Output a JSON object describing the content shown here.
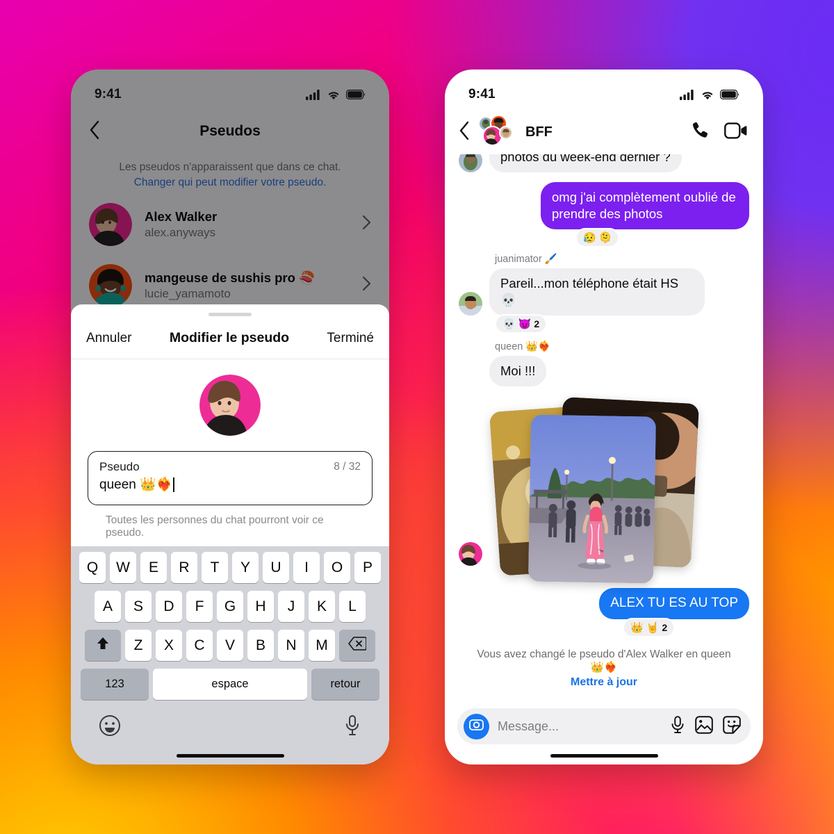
{
  "background": {
    "colors": [
      "#E800B0",
      "#FF2050",
      "#FF9000",
      "#FFC400",
      "#6A2BF5",
      "#FF1B6B"
    ]
  },
  "left_phone": {
    "status_bar": {
      "time": "9:41",
      "signal_icon": "cellular-bars-icon",
      "wifi_icon": "wifi-icon",
      "battery_icon": "battery-full-icon"
    },
    "nav": {
      "back_icon": "chevron-left-icon",
      "title": "Pseudos"
    },
    "subtitle": {
      "muted_text": "Les pseudos n'apparaissent que dans ce chat.",
      "link_text": "Changer qui peut modifier votre pseudo."
    },
    "people": [
      {
        "name": "Alex Walker",
        "handle": "alex.anyways",
        "chevron_icon": "chevron-right-icon",
        "avatar_bg": "#E8238E"
      },
      {
        "name": "mangeuse de sushis pro 🍣",
        "handle": "lucie_yamamoto",
        "chevron_icon": "chevron-right-icon",
        "avatar_bg": "#F04A12"
      }
    ],
    "sheet": {
      "grabber": "drag-handle",
      "cancel_label": "Annuler",
      "title": "Modifier le pseudo",
      "done_label": "Terminé",
      "avatar_name": "alex-walker-avatar",
      "field": {
        "label": "Pseudo",
        "value": "queen 👑❤️‍🔥",
        "counter": "8 / 32",
        "placeholder": "Pseudo"
      },
      "help_text": "Toutes les personnes du chat pourront voir ce pseudo."
    },
    "keyboard": {
      "row1": [
        "Q",
        "W",
        "E",
        "R",
        "T",
        "Y",
        "U",
        "I",
        "O",
        "P"
      ],
      "row2": [
        "A",
        "S",
        "D",
        "F",
        "G",
        "H",
        "J",
        "K",
        "L"
      ],
      "row3": [
        "Z",
        "X",
        "C",
        "V",
        "B",
        "N",
        "M"
      ],
      "shift_icon": "shift-arrow-icon",
      "delete_icon": "backspace-icon",
      "numbers_label": "123",
      "space_label": "espace",
      "return_label": "retour",
      "emoji_icon": "emoji-smiley-icon",
      "dictate_icon": "microphone-icon"
    }
  },
  "right_phone": {
    "status_bar": {
      "time": "9:41",
      "signal_icon": "cellular-bars-icon",
      "wifi_icon": "wifi-icon",
      "battery_icon": "battery-full-icon"
    },
    "thread_header": {
      "back_icon": "chevron-left-icon",
      "avatars_name": "group-avatar-cluster",
      "title": "BFF",
      "call_icon": "phone-call-icon",
      "video_icon": "video-camera-icon"
    },
    "messages": [
      {
        "id": "m1",
        "direction": "in",
        "text": "photos du week-end dernier ?",
        "partial_top": true,
        "avatar": "juanimator-avatar"
      },
      {
        "id": "m2",
        "direction": "out",
        "text": "omg j'ai complètement oublié de prendre des photos",
        "bubble_color": "#7C20EF",
        "reactions": {
          "emojis": [
            "😥",
            "🫠"
          ],
          "count": ""
        }
      },
      {
        "id": "m3",
        "direction": "in",
        "sender": "juanimator 🖌️",
        "text": "Pareil...mon téléphone était HS 💀",
        "avatar": "juanimator-avatar",
        "reactions": {
          "emojis": [
            "💀",
            "😈"
          ],
          "count": "2"
        }
      },
      {
        "id": "m4",
        "direction": "in",
        "sender": "queen 👑❤️‍🔥",
        "text": "Moi !!!"
      },
      {
        "id": "m5",
        "direction": "in",
        "type": "photo-stack",
        "avatar": "alex-walker-avatar",
        "photo_count": 3
      },
      {
        "id": "m6",
        "direction": "out",
        "text": "ALEX TU ES AU TOP",
        "bubble_color": "#1877F2",
        "reactions": {
          "emojis": [
            "👑",
            "🤘"
          ],
          "count": "2"
        }
      }
    ],
    "system_notice": {
      "text": "Vous avez changé le pseudo d'Alex Walker en queen👑❤️‍🔥",
      "action_label": "Mettre à jour"
    },
    "composer": {
      "camera_icon": "camera-icon",
      "placeholder": "Message...",
      "mic_icon": "microphone-icon",
      "gallery_icon": "photo-image-icon",
      "sticker_icon": "sticker-icon"
    }
  }
}
